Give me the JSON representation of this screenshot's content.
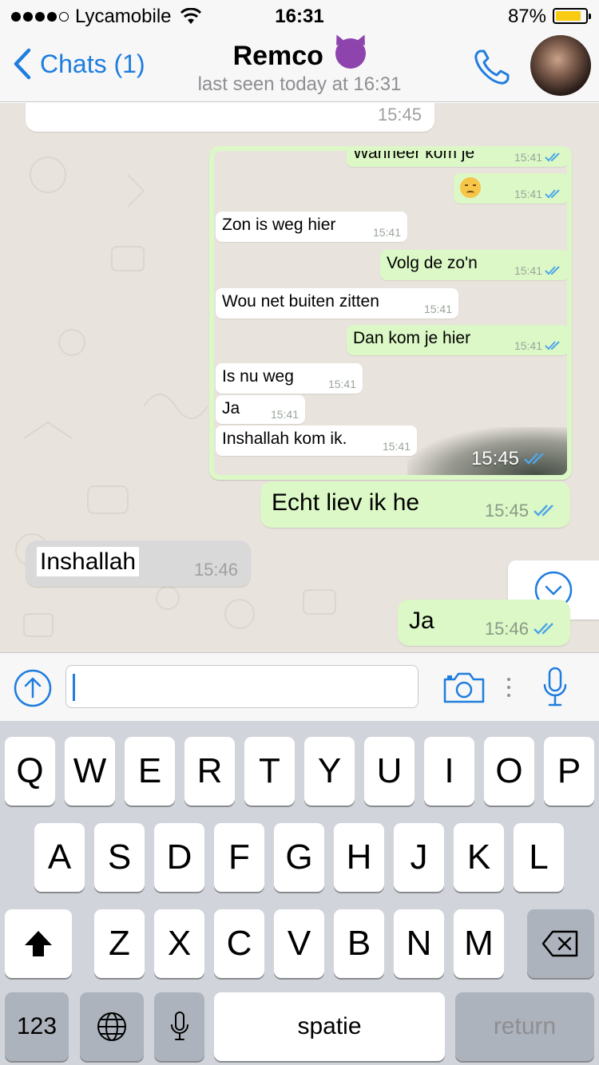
{
  "status_bar": {
    "carrier": "Lycamobile",
    "time": "16:31",
    "battery_percent": "87%",
    "battery_level": 0.87,
    "signal_bars_filled": 4,
    "signal_bars_total": 5
  },
  "nav": {
    "back_label": "Chats (1)",
    "contact_name": "Remco",
    "contact_emoji": "smiling-imp",
    "last_seen": "last seen today at 16:31"
  },
  "chat": {
    "top_partial_time": "15:45",
    "image_message": {
      "time": "15:45",
      "messages": [
        {
          "dir": "out",
          "text": "Wanneer kom je",
          "time": "15:41"
        },
        {
          "dir": "out",
          "text": "",
          "emoji": "disappointed-face",
          "time": "15:41"
        },
        {
          "dir": "in",
          "text": "Zon is weg hier",
          "time": "15:41"
        },
        {
          "dir": "out",
          "text": "Volg de zo'n",
          "time": "15:41"
        },
        {
          "dir": "in",
          "text": "Wou net buiten zitten",
          "time": "15:41"
        },
        {
          "dir": "out",
          "text": "Dan kom je hier",
          "time": "15:41"
        },
        {
          "dir": "in",
          "text": "Is nu weg",
          "time": "15:41"
        },
        {
          "dir": "in",
          "text": "Ja",
          "time": "15:41"
        },
        {
          "dir": "in",
          "text": "Inshallah kom ik.",
          "time": "15:41"
        }
      ]
    },
    "messages": [
      {
        "dir": "out",
        "text": "Echt liev ik he",
        "time": "15:45"
      },
      {
        "dir": "in",
        "text": "Inshallah",
        "time": "15:46"
      },
      {
        "dir": "out",
        "text": "Ja",
        "time": "15:46"
      }
    ]
  },
  "keyboard": {
    "row1": [
      "Q",
      "W",
      "E",
      "R",
      "T",
      "Y",
      "U",
      "I",
      "O",
      "P"
    ],
    "row2": [
      "A",
      "S",
      "D",
      "F",
      "G",
      "H",
      "J",
      "K",
      "L"
    ],
    "row3": [
      "Z",
      "X",
      "C",
      "V",
      "B",
      "N",
      "M"
    ],
    "numbers_key": "123",
    "space_key": "spatie",
    "return_key": "return"
  },
  "colors": {
    "accent": "#1f7dde",
    "outgoing_bubble": "#dcf8c6",
    "incoming_bubble": "#ffffff",
    "chat_background": "#e8e3dc",
    "read_ticks": "#4fa6e8"
  }
}
